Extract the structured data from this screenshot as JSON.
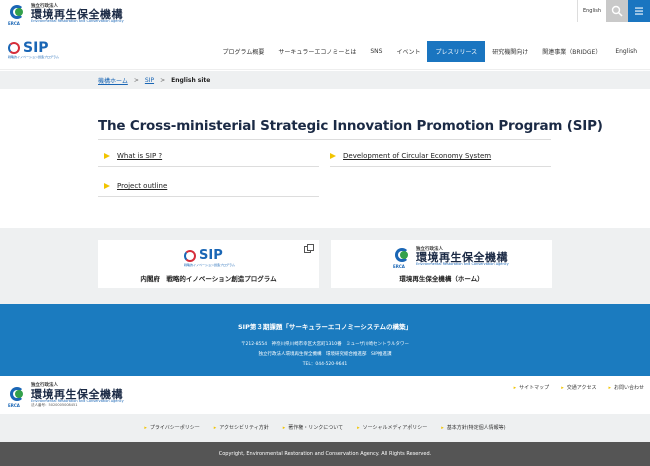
{
  "brand": {
    "org_small": "独立行政法人",
    "org_name": "環境再生保全機構",
    "org_en": "Environmental Restoration and Conservation Agency",
    "mark_text": "ERCA",
    "corp_no": "法人番号：5020005008451"
  },
  "topbar": {
    "lang_label": "English",
    "search_icon": "search-icon",
    "menu_icon": "hamburger-menu-icon"
  },
  "sip_logo": {
    "word": "SIP",
    "sub": "戦略的イノベーション創造プログラム"
  },
  "nav": {
    "items": [
      {
        "label": "プログラム概要"
      },
      {
        "label": "サーキュラーエコノミーとは"
      },
      {
        "label": "SNS"
      },
      {
        "label": "イベント"
      },
      {
        "label": "プレスリリース"
      },
      {
        "label": "研究機関向け"
      },
      {
        "label": "関連事業（BRIDGE）"
      },
      {
        "label": "English"
      }
    ],
    "active_index": 4
  },
  "breadcrumb": {
    "home": "機構ホーム",
    "sip": "SIP",
    "current": "English site",
    "sep": ">"
  },
  "main": {
    "title": "The Cross-ministerial Strategic Innovation Promotion Program (SIP)",
    "links": [
      {
        "label": "What is SIP ?"
      },
      {
        "label": "Development of Circular Economy System"
      },
      {
        "label": "Project outline"
      }
    ]
  },
  "cards": [
    {
      "label": "内閣府　戦略的イノベーション創造プログラム"
    },
    {
      "label": "環境再生保全機構（ホーム）"
    }
  ],
  "blueband": {
    "title": "SIP第３期課題「サーキュラーエコノミーシステムの構築」",
    "address": "〒212-8554　神奈川県川崎市幸区大宮町1310番　ミューザ川崎セントラルタワー",
    "dept": "独立行政法人環境再生保全機構　環境研究総合推進部　SIP推進課",
    "tel": "TEL：044-520-9641"
  },
  "footer": {
    "links": [
      {
        "label": "サイトマップ"
      },
      {
        "label": "交通アクセス"
      },
      {
        "label": "お問い合わせ"
      }
    ],
    "policies": [
      {
        "label": "プライバシーポリシー"
      },
      {
        "label": "アクセシビリティ方針"
      },
      {
        "label": "著作権・リンクについて"
      },
      {
        "label": "ソーシャルメディアポリシー"
      },
      {
        "label": "基本方針(特定個人情報等)"
      }
    ],
    "copyright": "Copyright, Environmental Restoration and Conservation Agency. All Rights Reserved."
  },
  "colors": {
    "accent_blue": "#1a75c0",
    "band_blue": "#1b7bbf",
    "marker_yellow": "#f1c400",
    "light_gray": "#eef0f1"
  }
}
